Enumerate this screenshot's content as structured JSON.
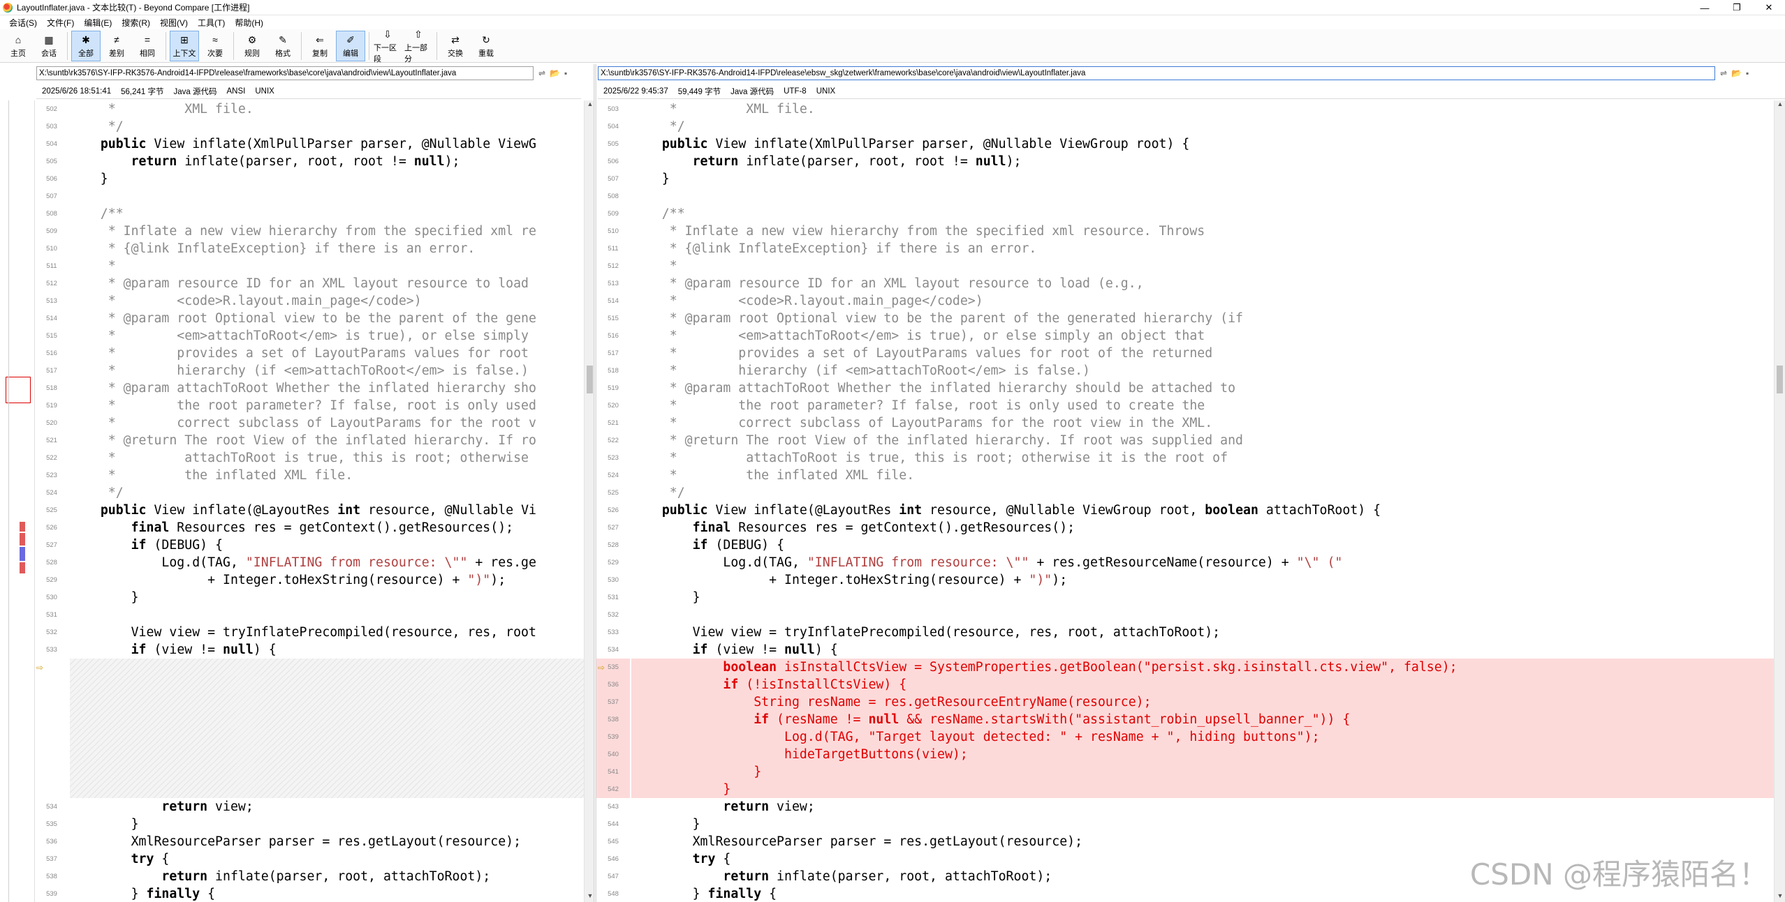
{
  "window": {
    "title": "LayoutInflater.java - 文本比较(T) - Beyond Compare [工作进程]",
    "controls": [
      "—",
      "❐",
      "✕"
    ]
  },
  "menu": [
    "会话(S)",
    "文件(F)",
    "编辑(E)",
    "搜索(R)",
    "视图(V)",
    "工具(T)",
    "帮助(H)"
  ],
  "toolbar": [
    {
      "label": "主页",
      "icon": "home-icon",
      "glyph": "⌂",
      "active": false
    },
    {
      "label": "会话",
      "icon": "session-icon",
      "glyph": "▦",
      "active": false
    },
    {
      "label": "全部",
      "icon": "all-icon",
      "glyph": "✱",
      "active": true
    },
    {
      "label": "差别",
      "icon": "diff-icon",
      "glyph": "≠",
      "active": false
    },
    {
      "label": "相同",
      "icon": "same-icon",
      "glyph": "=",
      "active": false
    },
    {
      "label": "上下文",
      "icon": "context-icon",
      "glyph": "⊞",
      "active": true
    },
    {
      "label": "次要",
      "icon": "minor-icon",
      "glyph": "≈",
      "active": false
    },
    {
      "label": "规则",
      "icon": "rules-icon",
      "glyph": "⚙",
      "active": false
    },
    {
      "label": "格式",
      "icon": "format-icon",
      "glyph": "✎",
      "active": false
    },
    {
      "label": "复制",
      "icon": "copy-icon",
      "glyph": "⇐",
      "active": false
    },
    {
      "label": "编辑",
      "icon": "edit-icon",
      "glyph": "✐",
      "active": true
    },
    {
      "label": "下一区段",
      "icon": "next-section-icon",
      "glyph": "⇩",
      "active": false
    },
    {
      "label": "上一部分",
      "icon": "prev-section-icon",
      "glyph": "⇧",
      "active": false
    },
    {
      "label": "交换",
      "icon": "swap-icon",
      "glyph": "⇄",
      "active": false
    },
    {
      "label": "重载",
      "icon": "reload-icon",
      "glyph": "↻",
      "active": false
    }
  ],
  "left": {
    "path": "X:\\suntb\\rk3576\\SY-IFP-RK3576-Android14-IFPD\\release\\frameworks\\base\\core\\java\\android\\view\\LayoutInflater.java",
    "date": "2025/6/26 18:51:41",
    "size": "56,241 字节",
    "format": "Java 源代码",
    "encoding": "ANSI",
    "eol": "UNIX"
  },
  "right": {
    "path": "X:\\suntb\\rk3576\\SY-IFP-RK3576-Android14-IFPD\\release\\ebsw_skg\\zetwerk\\frameworks\\base\\core\\java\\android\\view\\LayoutInflater.java",
    "date": "2025/6/22 9:45:37",
    "size": "59,449 字节",
    "format": "Java 源代码",
    "encoding": "UTF-8",
    "eol": "UNIX"
  },
  "left_lines": [
    {
      "n": "502",
      "t": "     *         XML file.",
      "c": "c"
    },
    {
      "n": "503",
      "t": "     */",
      "c": "c"
    },
    {
      "n": "504",
      "t": "    public View inflate(XmlPullParser parser, @Nullable ViewG",
      "c": ""
    },
    {
      "n": "505",
      "t": "        return inflate(parser, root, root != null);",
      "c": ""
    },
    {
      "n": "506",
      "t": "    }",
      "c": ""
    },
    {
      "n": "507",
      "t": "",
      "c": ""
    },
    {
      "n": "508",
      "t": "    /**",
      "c": "c"
    },
    {
      "n": "509",
      "t": "     * Inflate a new view hierarchy from the specified xml re",
      "c": "c"
    },
    {
      "n": "510",
      "t": "     * {@link InflateException} if there is an error.",
      "c": "c"
    },
    {
      "n": "511",
      "t": "     *",
      "c": "c"
    },
    {
      "n": "512",
      "t": "     * @param resource ID for an XML layout resource to load",
      "c": "c"
    },
    {
      "n": "513",
      "t": "     *        <code>R.layout.main_page</code>)",
      "c": "c"
    },
    {
      "n": "514",
      "t": "     * @param root Optional view to be the parent of the gene",
      "c": "c"
    },
    {
      "n": "515",
      "t": "     *        <em>attachToRoot</em> is true), or else simply",
      "c": "c"
    },
    {
      "n": "516",
      "t": "     *        provides a set of LayoutParams values for root",
      "c": "c"
    },
    {
      "n": "517",
      "t": "     *        hierarchy (if <em>attachToRoot</em> is false.)",
      "c": "c"
    },
    {
      "n": "518",
      "t": "     * @param attachToRoot Whether the inflated hierarchy sho",
      "c": "c"
    },
    {
      "n": "519",
      "t": "     *        the root parameter? If false, root is only used",
      "c": "c"
    },
    {
      "n": "520",
      "t": "     *        correct subclass of LayoutParams for the root v",
      "c": "c"
    },
    {
      "n": "521",
      "t": "     * @return The root View of the inflated hierarchy. If ro",
      "c": "c"
    },
    {
      "n": "522",
      "t": "     *         attachToRoot is true, this is root; otherwise",
      "c": "c"
    },
    {
      "n": "523",
      "t": "     *         the inflated XML file.",
      "c": "c"
    },
    {
      "n": "524",
      "t": "     */",
      "c": "c"
    },
    {
      "n": "525",
      "t": "    public View inflate(@LayoutRes int resource, @Nullable Vi",
      "c": ""
    },
    {
      "n": "526",
      "t": "        final Resources res = getContext().getResources();",
      "c": ""
    },
    {
      "n": "527",
      "t": "        if (DEBUG) {",
      "c": ""
    },
    {
      "n": "528",
      "t": "            Log.d(TAG, \"INFLATING from resource: \\\"\" + res.ge",
      "c": ""
    },
    {
      "n": "529",
      "t": "                  + Integer.toHexString(resource) + \")\");",
      "c": ""
    },
    {
      "n": "530",
      "t": "        }",
      "c": ""
    },
    {
      "n": "531",
      "t": "",
      "c": ""
    },
    {
      "n": "532",
      "t": "        View view = tryInflatePrecompiled(resource, res, root",
      "c": ""
    },
    {
      "n": "533",
      "t": "        if (view != null) {",
      "c": ""
    },
    {
      "n": "",
      "t": "",
      "c": "ph"
    },
    {
      "n": "",
      "t": "",
      "c": "ph"
    },
    {
      "n": "",
      "t": "",
      "c": "ph"
    },
    {
      "n": "",
      "t": "",
      "c": "ph"
    },
    {
      "n": "",
      "t": "",
      "c": "ph"
    },
    {
      "n": "",
      "t": "",
      "c": "ph"
    },
    {
      "n": "",
      "t": "",
      "c": "ph"
    },
    {
      "n": "",
      "t": "",
      "c": "ph"
    },
    {
      "n": "534",
      "t": "            return view;",
      "c": ""
    },
    {
      "n": "535",
      "t": "        }",
      "c": ""
    },
    {
      "n": "536",
      "t": "        XmlResourceParser parser = res.getLayout(resource);",
      "c": ""
    },
    {
      "n": "537",
      "t": "        try {",
      "c": ""
    },
    {
      "n": "538",
      "t": "            return inflate(parser, root, attachToRoot);",
      "c": ""
    },
    {
      "n": "539",
      "t": "        } finally {",
      "c": ""
    }
  ],
  "right_lines": [
    {
      "n": "503",
      "t": "     *         XML file.",
      "c": "c"
    },
    {
      "n": "504",
      "t": "     */",
      "c": "c"
    },
    {
      "n": "505",
      "t": "    public View inflate(XmlPullParser parser, @Nullable ViewGroup root) {",
      "c": ""
    },
    {
      "n": "506",
      "t": "        return inflate(parser, root, root != null);",
      "c": ""
    },
    {
      "n": "507",
      "t": "    }",
      "c": ""
    },
    {
      "n": "508",
      "t": "",
      "c": ""
    },
    {
      "n": "509",
      "t": "    /**",
      "c": "c"
    },
    {
      "n": "510",
      "t": "     * Inflate a new view hierarchy from the specified xml resource. Throws",
      "c": "c"
    },
    {
      "n": "511",
      "t": "     * {@link InflateException} if there is an error.",
      "c": "c"
    },
    {
      "n": "512",
      "t": "     *",
      "c": "c"
    },
    {
      "n": "513",
      "t": "     * @param resource ID for an XML layout resource to load (e.g.,",
      "c": "c"
    },
    {
      "n": "514",
      "t": "     *        <code>R.layout.main_page</code>)",
      "c": "c"
    },
    {
      "n": "515",
      "t": "     * @param root Optional view to be the parent of the generated hierarchy (if",
      "c": "c"
    },
    {
      "n": "516",
      "t": "     *        <em>attachToRoot</em> is true), or else simply an object that",
      "c": "c"
    },
    {
      "n": "517",
      "t": "     *        provides a set of LayoutParams values for root of the returned",
      "c": "c"
    },
    {
      "n": "518",
      "t": "     *        hierarchy (if <em>attachToRoot</em> is false.)",
      "c": "c"
    },
    {
      "n": "519",
      "t": "     * @param attachToRoot Whether the inflated hierarchy should be attached to",
      "c": "c"
    },
    {
      "n": "520",
      "t": "     *        the root parameter? If false, root is only used to create the",
      "c": "c"
    },
    {
      "n": "521",
      "t": "     *        correct subclass of LayoutParams for the root view in the XML.",
      "c": "c"
    },
    {
      "n": "522",
      "t": "     * @return The root View of the inflated hierarchy. If root was supplied and",
      "c": "c"
    },
    {
      "n": "523",
      "t": "     *         attachToRoot is true, this is root; otherwise it is the root of",
      "c": "c"
    },
    {
      "n": "524",
      "t": "     *         the inflated XML file.",
      "c": "c"
    },
    {
      "n": "525",
      "t": "     */",
      "c": "c"
    },
    {
      "n": "526",
      "t": "    public View inflate(@LayoutRes int resource, @Nullable ViewGroup root, boolean attachToRoot) {",
      "c": ""
    },
    {
      "n": "527",
      "t": "        final Resources res = getContext().getResources();",
      "c": ""
    },
    {
      "n": "528",
      "t": "        if (DEBUG) {",
      "c": ""
    },
    {
      "n": "529",
      "t": "            Log.d(TAG, \"INFLATING from resource: \\\"\" + res.getResourceName(resource) + \"\\\" (\"",
      "c": ""
    },
    {
      "n": "530",
      "t": "                  + Integer.toHexString(resource) + \")\");",
      "c": ""
    },
    {
      "n": "531",
      "t": "        }",
      "c": ""
    },
    {
      "n": "532",
      "t": "",
      "c": ""
    },
    {
      "n": "533",
      "t": "        View view = tryInflatePrecompiled(resource, res, root, attachToRoot);",
      "c": ""
    },
    {
      "n": "534",
      "t": "        if (view != null) {",
      "c": ""
    },
    {
      "n": "535",
      "t": "            boolean isInstallCtsView = SystemProperties.getBoolean(\"persist.skg.isinstall.cts.view\", false);",
      "c": "d"
    },
    {
      "n": "536",
      "t": "            if (!isInstallCtsView) {",
      "c": "d"
    },
    {
      "n": "537",
      "t": "                String resName = res.getResourceEntryName(resource);",
      "c": "d"
    },
    {
      "n": "538",
      "t": "                if (resName != null && resName.startsWith(\"assistant_robin_upsell_banner_\")) {",
      "c": "d"
    },
    {
      "n": "539",
      "t": "                    Log.d(TAG, \"Target layout detected: \" + resName + \", hiding buttons\");",
      "c": "d"
    },
    {
      "n": "540",
      "t": "                    hideTargetButtons(view);",
      "c": "d"
    },
    {
      "n": "541",
      "t": "                }",
      "c": "d"
    },
    {
      "n": "542",
      "t": "            }",
      "c": "d"
    },
    {
      "n": "543",
      "t": "            return view;",
      "c": ""
    },
    {
      "n": "544",
      "t": "        }",
      "c": ""
    },
    {
      "n": "545",
      "t": "        XmlResourceParser parser = res.getLayout(resource);",
      "c": ""
    },
    {
      "n": "546",
      "t": "        try {",
      "c": ""
    },
    {
      "n": "547",
      "t": "            return inflate(parser, root, attachToRoot);",
      "c": ""
    },
    {
      "n": "548",
      "t": "        } finally {",
      "c": ""
    }
  ],
  "watermark": "CSDN @程序猿陌名！",
  "colors": {
    "diff_bg": "#fddada",
    "diff_text": "#e00000",
    "comment": "#8a8a8a",
    "toolbar_active": "#cfe4fb"
  }
}
